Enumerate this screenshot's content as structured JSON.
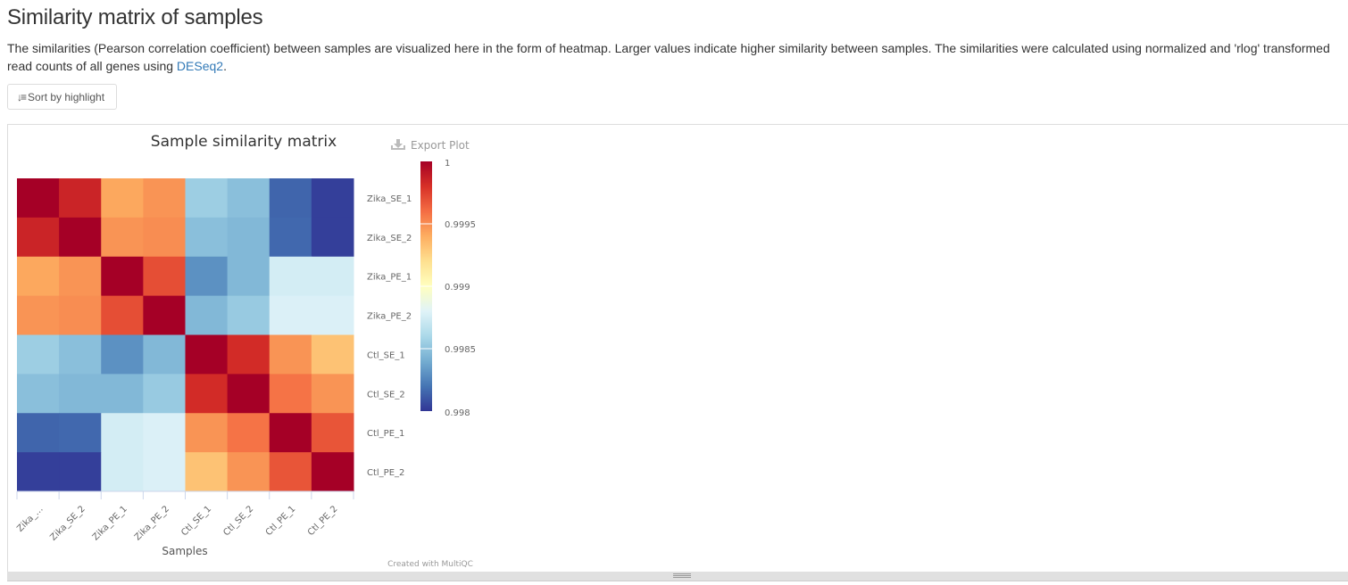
{
  "page": {
    "title": "Similarity matrix of samples",
    "description_prefix": "The similarities (Pearson correlation coefficient) between samples are visualized here in the form of heatmap. Larger values indicate higher similarity between samples. The similarities were calculated using normalized and 'rlog' transformed read counts of all genes using ",
    "description_link": "DESeq2",
    "description_suffix": ".",
    "sort_button": {
      "icon": "sort-amount-icon",
      "label": "Sort by highlight"
    }
  },
  "plot": {
    "export_label": "Export Plot",
    "export_icon": "download-icon",
    "credit": "Created with MultiQC"
  },
  "chart_data": {
    "type": "heatmap",
    "title": "Sample similarity matrix",
    "xlabel": "Samples",
    "ylabel": "",
    "x_tick_labels": [
      "Zika_…",
      "Zika_SE_2",
      "Zika_PE_1",
      "Zika_PE_2",
      "Ctl_SE_1",
      "Ctl_SE_2",
      "Ctl_PE_1",
      "Ctl_PE_2"
    ],
    "y_tick_labels": [
      "Zika_SE_1",
      "Zika_SE_2",
      "Zika_PE_1",
      "Zika_PE_2",
      "Ctl_SE_1",
      "Ctl_SE_2",
      "Ctl_PE_1",
      "Ctl_PE_2"
    ],
    "samples": [
      "Zika_SE_1",
      "Zika_SE_2",
      "Zika_PE_1",
      "Zika_PE_2",
      "Ctl_SE_1",
      "Ctl_SE_2",
      "Ctl_PE_1",
      "Ctl_PE_2"
    ],
    "values": [
      [
        1.0,
        0.99985,
        0.99942,
        0.99948,
        0.99855,
        0.99848,
        0.99815,
        0.99803
      ],
      [
        0.99985,
        1.0,
        0.99948,
        0.9995,
        0.99848,
        0.99845,
        0.99816,
        0.99803
      ],
      [
        0.99942,
        0.99948,
        1.0,
        0.9997,
        0.9983,
        0.99845,
        0.99875,
        0.99875
      ],
      [
        0.99948,
        0.9995,
        0.9997,
        1.0,
        0.99845,
        0.99853,
        0.99878,
        0.99878
      ],
      [
        0.99855,
        0.99848,
        0.9983,
        0.99845,
        1.0,
        0.99982,
        0.99948,
        0.99932
      ],
      [
        0.99848,
        0.99845,
        0.99845,
        0.99853,
        0.99982,
        1.0,
        0.99958,
        0.99948
      ],
      [
        0.99815,
        0.99816,
        0.99875,
        0.99878,
        0.99948,
        0.99958,
        1.0,
        0.99968
      ],
      [
        0.99803,
        0.99803,
        0.99875,
        0.99878,
        0.99932,
        0.99948,
        0.99968,
        1.0
      ]
    ],
    "colorbar": {
      "min": 0.998,
      "max": 1,
      "ticks": [
        1,
        0.9995,
        0.999,
        0.9985,
        0.998
      ],
      "tick_labels": [
        "1",
        "0.9995",
        "0.999",
        "0.9985",
        "0.998"
      ],
      "colorscale": [
        "#313695",
        "#4575b4",
        "#74add1",
        "#abd9e9",
        "#e0f3f8",
        "#ffffbf",
        "#fee090",
        "#fdae61",
        "#f46d43",
        "#d73027",
        "#a50026"
      ]
    }
  }
}
